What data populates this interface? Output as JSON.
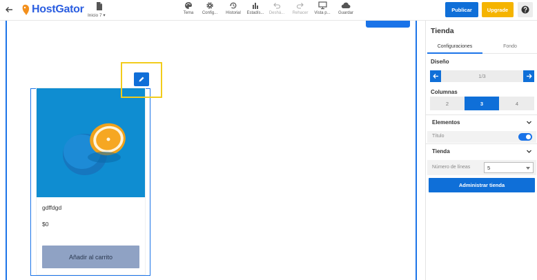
{
  "header": {
    "logo_text": "HostGator",
    "page_selector": "Inicio 7",
    "tools": [
      {
        "label": "Tema",
        "icon": "palette-icon",
        "disabled": false
      },
      {
        "label": "Config...",
        "icon": "gear-icon",
        "disabled": false
      },
      {
        "label": "Historial",
        "icon": "history-icon",
        "disabled": false
      },
      {
        "label": "Estadís...",
        "icon": "bar-chart-icon",
        "disabled": false
      },
      {
        "label": "Deshá...",
        "icon": "undo-icon",
        "disabled": true
      },
      {
        "label": "Rehacer",
        "icon": "redo-icon",
        "disabled": true
      },
      {
        "label": "Vista p...",
        "icon": "monitor-icon",
        "disabled": false
      },
      {
        "label": "Guardar",
        "icon": "cloud-icon",
        "disabled": false
      }
    ],
    "publish_label": "Publicar",
    "upgrade_label": "Upgrade",
    "help_icon": "help-icon",
    "colors": {
      "primary": "#0f6fd8",
      "upgrade": "#f5b400",
      "highlight": "#f2cc1b"
    }
  },
  "canvas": {
    "product": {
      "name": "gdffdgd",
      "price": "$0",
      "cart_button": "Añadir al carrito"
    }
  },
  "panel": {
    "title": "Tienda",
    "tabs": [
      "Configuraciones",
      "Fondo"
    ],
    "design_label": "Diseño",
    "design_page": "1/3",
    "columns_label": "Columnas",
    "columns": [
      "2",
      "3",
      "4"
    ],
    "columns_selected": "3",
    "elements_label": "Elementos",
    "title_toggle_label": "Título",
    "store_label": "Tienda",
    "lines_label": "Número de líneas",
    "lines_value": "5",
    "admin_button": "Administrar tienda"
  }
}
